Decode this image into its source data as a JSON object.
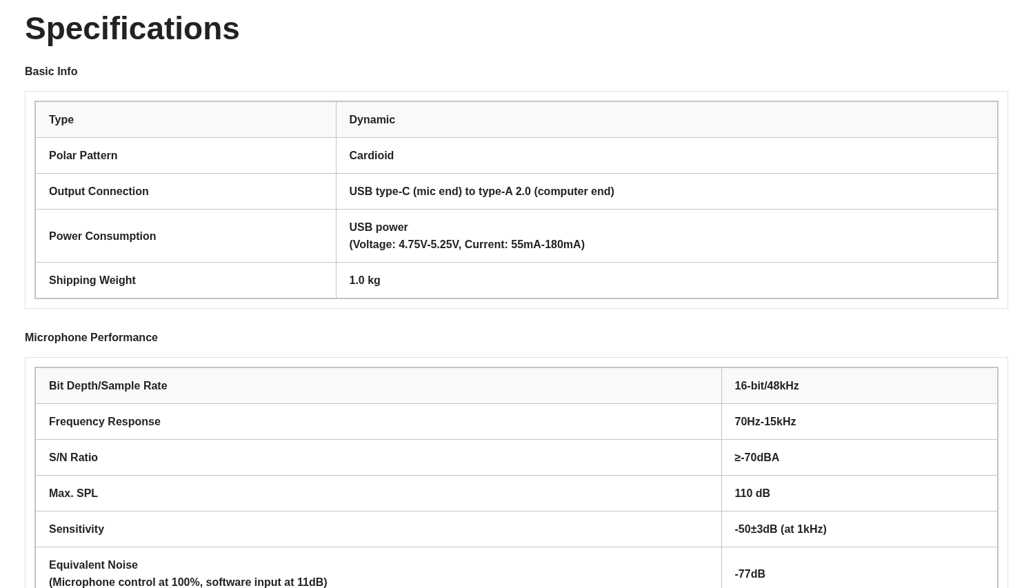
{
  "title": "Specifications",
  "sections": [
    {
      "title": "Basic Info",
      "rows": [
        {
          "label": [
            "Type"
          ],
          "value": [
            "Dynamic"
          ]
        },
        {
          "label": [
            "Polar Pattern"
          ],
          "value": [
            "Cardioid"
          ]
        },
        {
          "label": [
            "Output Connection"
          ],
          "value": [
            "USB type-C (mic end) to type-A 2.0 (computer end)"
          ]
        },
        {
          "label": [
            "Power Consumption"
          ],
          "value": [
            "USB power",
            "(Voltage: 4.75V-5.25V, Current: 55mA-180mA)"
          ]
        },
        {
          "label": [
            "Shipping Weight"
          ],
          "value": [
            "1.0 kg"
          ]
        }
      ]
    },
    {
      "title": "Microphone Performance",
      "rows": [
        {
          "label": [
            "Bit Depth/Sample Rate"
          ],
          "value": [
            "16-bit/48kHz"
          ]
        },
        {
          "label": [
            "Frequency Response"
          ],
          "value": [
            "70Hz-15kHz"
          ]
        },
        {
          "label": [
            "S/N Ratio"
          ],
          "value": [
            "≥-70dBA"
          ]
        },
        {
          "label": [
            "Max. SPL"
          ],
          "value": [
            "110 dB"
          ]
        },
        {
          "label": [
            "Sensitivity"
          ],
          "value": [
            "-50±3dB (at 1kHz)"
          ]
        },
        {
          "label": [
            "Equivalent Noise",
            "(Microphone control at 100%, software input at 11dB)"
          ],
          "value": [
            "-77dB"
          ]
        }
      ]
    }
  ]
}
